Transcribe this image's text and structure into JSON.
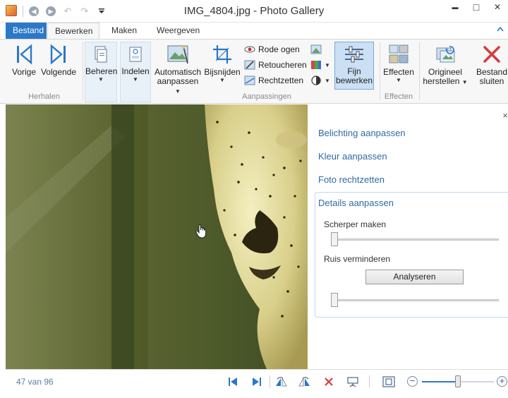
{
  "window": {
    "title": "IMG_4804.jpg - Photo Gallery",
    "minimize": "▬",
    "maximize": "□",
    "close": "✕"
  },
  "quick_access": {
    "back_icon": "back-arrow-icon",
    "forward_icon": "forward-arrow-icon",
    "undo_icon": "undo-icon",
    "redo_icon": "redo-icon",
    "customize_icon": "dropdown-icon"
  },
  "tabs": [
    {
      "label": "Bestand"
    },
    {
      "label": "Bewerken"
    },
    {
      "label": "Maken"
    },
    {
      "label": "Weergeven"
    }
  ],
  "ribbon": {
    "groups": {
      "herhalen": "Herhalen",
      "aanpassingen": "Aanpassingen",
      "effecten": "Effecten"
    },
    "buttons": {
      "vorige": "Vorige",
      "volgende": "Volgende",
      "beheren": "Beheren",
      "indelen": "Indelen",
      "auto_line1": "Automatisch",
      "auto_line2": "aanpassen",
      "bijsnijden": "Bijsnijden",
      "rode_ogen": "Rode ogen",
      "retoucheren": "Retoucheren",
      "rechtzetten": "Rechtzetten",
      "fijn_line1": "Fijn",
      "fijn_line2": "bewerken",
      "effecten": "Effecten",
      "origineel_line1": "Origineel",
      "origineel_line2": "herstellen",
      "bestand_line1": "Bestand",
      "bestand_line2": "sluiten"
    },
    "collapse": "^"
  },
  "panel": {
    "close": "×",
    "links": {
      "belichting": "Belichting aanpassen",
      "kleur": "Kleur aanpassen",
      "rechtzetten": "Foto rechtzetten",
      "details": "Details aanpassen"
    },
    "sharpen_label": "Scherper maken",
    "sharpen_value": 0,
    "noise_label": "Ruis verminderen",
    "noise_value": 0,
    "analyze_button": "Analyseren"
  },
  "status": {
    "count": "47 van 96",
    "zoom_level": 0.5
  },
  "colors": {
    "accent": "#2b78c7",
    "link": "#2f6aa6",
    "delete_red": "#d83b3b"
  }
}
